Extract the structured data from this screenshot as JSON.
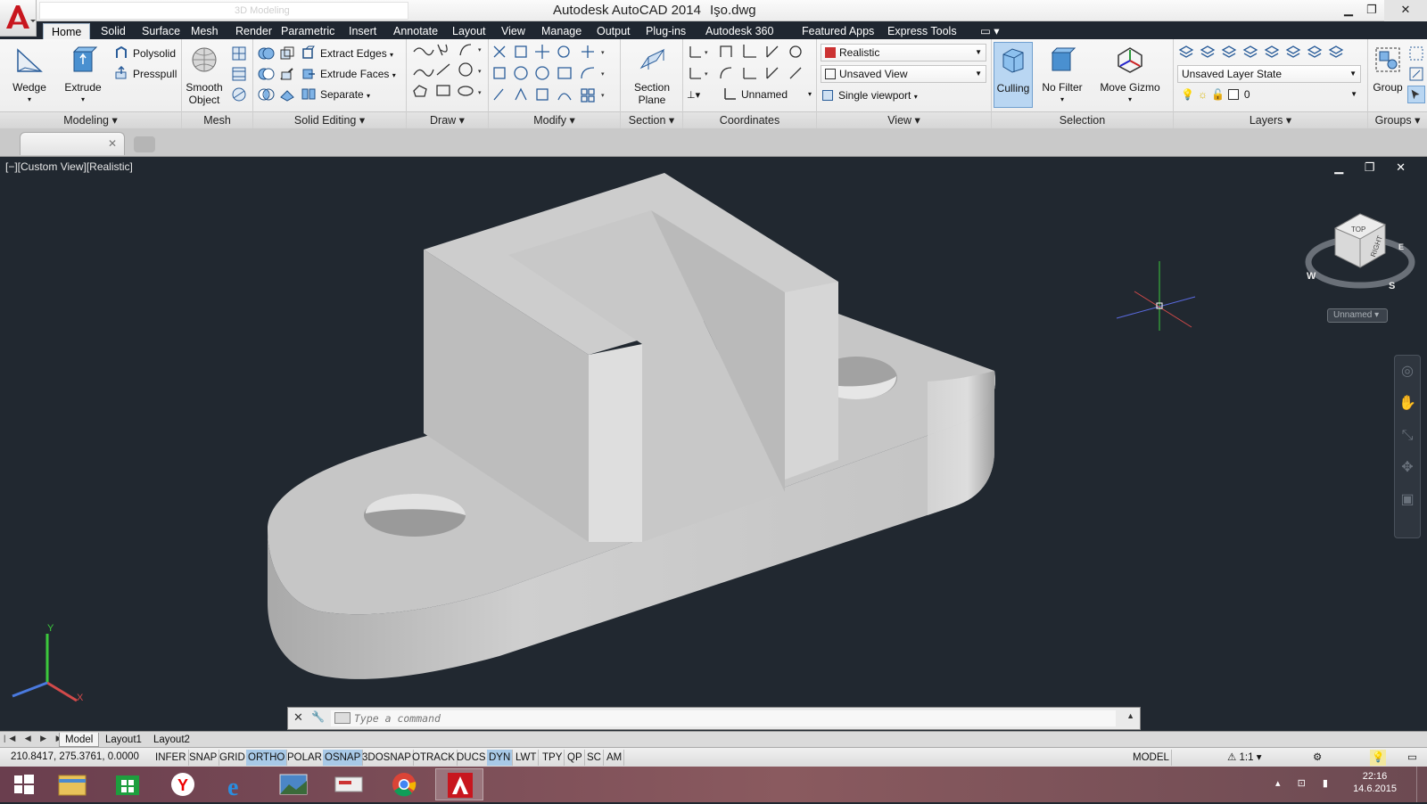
{
  "app": {
    "title": "Autodesk AutoCAD 2014",
    "filename": "Işo.dwg",
    "workspace": "3D Modeling",
    "logo_letter": "A"
  },
  "ribbon_tabs": [
    "Home",
    "Solid",
    "Surface",
    "Mesh",
    "Render",
    "Parametric",
    "Insert",
    "Annotate",
    "Layout",
    "View",
    "Manage",
    "Output",
    "Plug-ins",
    "Autodesk 360",
    "Featured Apps",
    "Express Tools"
  ],
  "panels": {
    "modeling": {
      "title": "Modeling ▾",
      "wedge": "Wedge",
      "extrude": "Extrude",
      "polysolid": "Polysolid",
      "presspull": "Presspull"
    },
    "mesh": {
      "title": "Mesh",
      "smooth_object": "Smooth Object"
    },
    "solid_editing": {
      "title": "Solid Editing ▾",
      "extract_edges": "Extract Edges",
      "extrude_faces": "Extrude Faces",
      "separate": "Separate"
    },
    "draw": {
      "title": "Draw ▾"
    },
    "modify": {
      "title": "Modify ▾"
    },
    "section": {
      "title": "Section ▾",
      "section_plane": "Section Plane"
    },
    "coordinates": {
      "title": "Coordinates",
      "ucs_name": "Unnamed"
    },
    "view": {
      "title": "View ▾",
      "visual_style": "Realistic",
      "named_view": "Unsaved View",
      "viewport_config": "Single viewport"
    },
    "selection": {
      "title": "Selection",
      "culling": "Culling",
      "no_filter": "No Filter",
      "move_gizmo": "Move Gizmo"
    },
    "layers": {
      "title": "Layers ▾",
      "layer_state": "Unsaved Layer State",
      "current_layer": "0"
    },
    "groups": {
      "title": "Groups ▾",
      "group": "Group"
    }
  },
  "viewport": {
    "label": "[−][Custom View][Realistic]",
    "controls": "▁ ❐ ✕",
    "viewcube": {
      "top": "TOP",
      "right": "RIGHT",
      "compass_w": "W",
      "compass_s": "S",
      "compass_e": "E",
      "ucs_name": "Unnamed"
    },
    "ucs_axes": {
      "x": "X",
      "y": "Y"
    }
  },
  "command_line": {
    "placeholder": "Type a command"
  },
  "layout_tabs": [
    "Model",
    "Layout1",
    "Layout2"
  ],
  "status": {
    "coordinates": "210.8417, 275.3761, 0.0000",
    "toggles": [
      {
        "label": "INFER",
        "on": false
      },
      {
        "label": "SNAP",
        "on": false
      },
      {
        "label": "GRID",
        "on": false
      },
      {
        "label": "ORTHO",
        "on": true
      },
      {
        "label": "POLAR",
        "on": false
      },
      {
        "label": "OSNAP",
        "on": true
      },
      {
        "label": "3DOSNAP",
        "on": false
      },
      {
        "label": "OTRACK",
        "on": false
      },
      {
        "label": "DUCS",
        "on": false
      },
      {
        "label": "DYN",
        "on": true
      },
      {
        "label": "LWT",
        "on": false
      },
      {
        "label": "TPY",
        "on": false
      },
      {
        "label": "QP",
        "on": false
      },
      {
        "label": "SC",
        "on": false
      },
      {
        "label": "AM",
        "on": false
      }
    ],
    "space": "MODEL",
    "scale": "1:1"
  },
  "taskbar": {
    "time": "22:16",
    "date": "14.6.2015"
  },
  "colors": {
    "accent": "#a8c9e7",
    "autocad_red": "#c8161e",
    "viewport_bg": "#212830",
    "ribbon_bg": "#ececec"
  }
}
